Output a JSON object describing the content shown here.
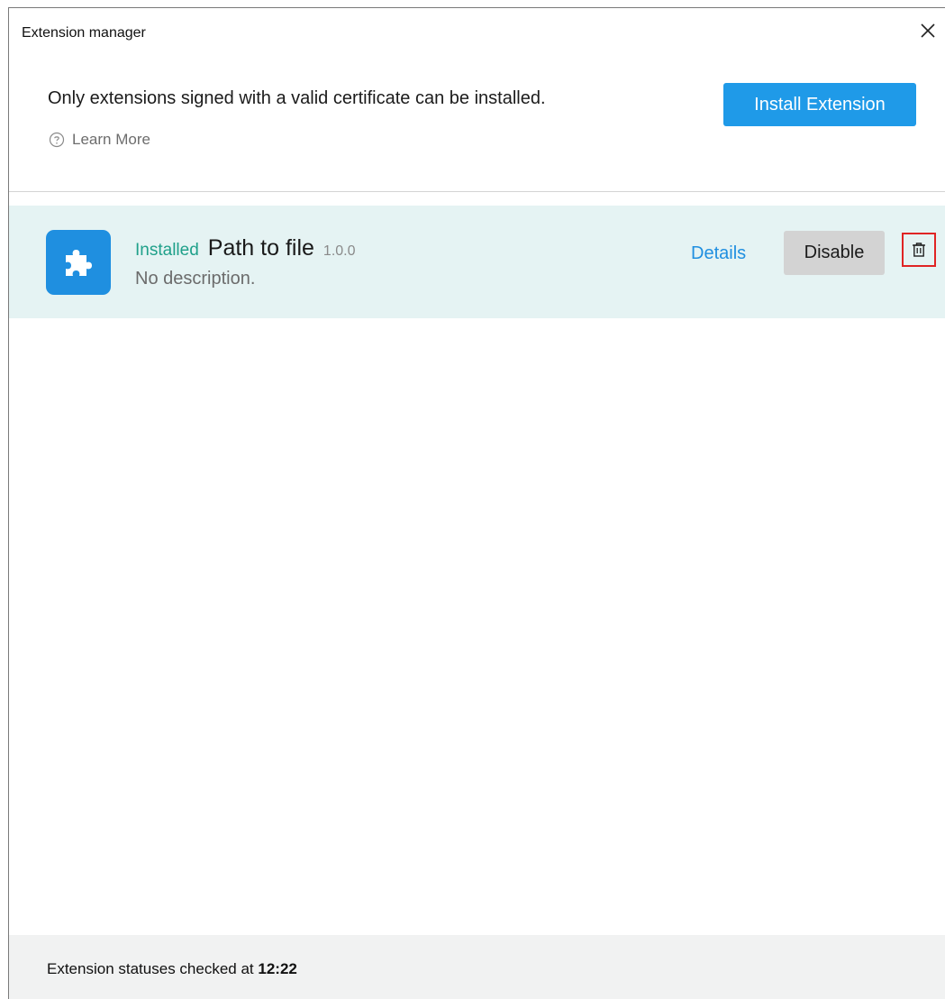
{
  "window": {
    "title": "Extension manager"
  },
  "header": {
    "notice": "Only extensions signed with a valid certificate can be installed.",
    "learn_more": "Learn More",
    "install_button": "Install Extension"
  },
  "extensions": [
    {
      "status": "Installed",
      "name": "Path to file",
      "version": "1.0.0",
      "description": "No description.",
      "details_label": "Details",
      "disable_label": "Disable",
      "icon": "puzzle-icon"
    }
  ],
  "footer": {
    "text": "Extension statuses checked at",
    "time": "12:22"
  },
  "colors": {
    "accent": "#1f9ae8",
    "installed": "#1fa08a",
    "row_highlight": "#e5f3f3",
    "focus_outline": "#e02424"
  }
}
